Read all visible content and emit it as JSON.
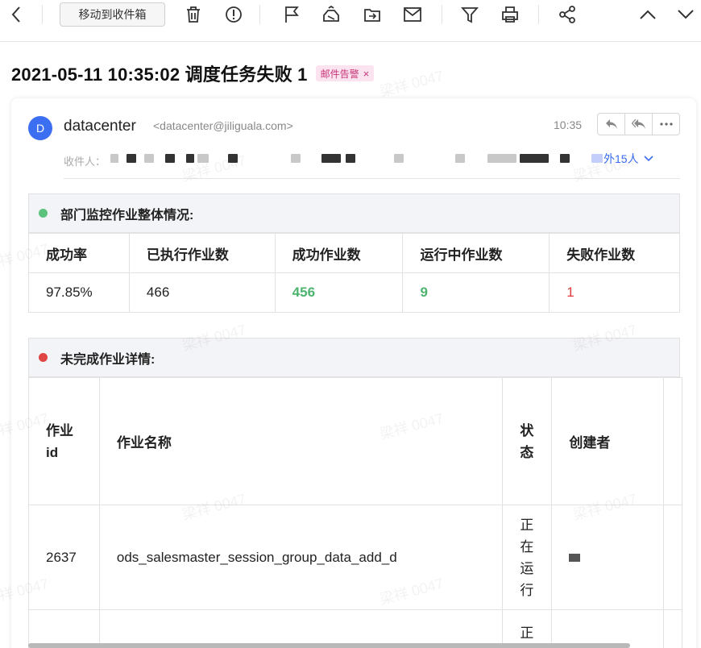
{
  "toolbar": {
    "move_label": "移动到收件箱"
  },
  "subject": {
    "title": "2021-05-11 10:35:02 调度任务失败 1",
    "tag": "邮件告警",
    "tag_close": "×"
  },
  "mail": {
    "avatar_letter": "D",
    "sender_name": "datacenter",
    "sender_email": "<datacenter@jiliguala.com>",
    "time": "10:35",
    "recipients_label": "收件人：",
    "more_recipients": "外15人"
  },
  "summary": {
    "heading": "部门监控作业整体情况:",
    "headers": [
      "成功率",
      "已执行作业数",
      "成功作业数",
      "运行中作业数",
      "失败作业数"
    ],
    "values": [
      "97.85%",
      "466",
      "456",
      "9",
      "1"
    ]
  },
  "detail": {
    "heading": "未完成作业详情:",
    "headers": {
      "id": "作业id",
      "name": "作业名称",
      "status": "状态",
      "creator": "创建者"
    },
    "rows": [
      {
        "id": "2637",
        "name": "ods_salesmaster_session_group_data_add_d",
        "status": "正在运行"
      },
      {
        "id": "",
        "name": "",
        "status": "正"
      }
    ]
  },
  "watermark": "梁祥 0047",
  "colors": {
    "accent": "#3b6ef0",
    "success": "#4cb46e",
    "failure": "#e03b3b",
    "tag_bg": "#fbe3ef",
    "tag_text": "#c8357a"
  }
}
